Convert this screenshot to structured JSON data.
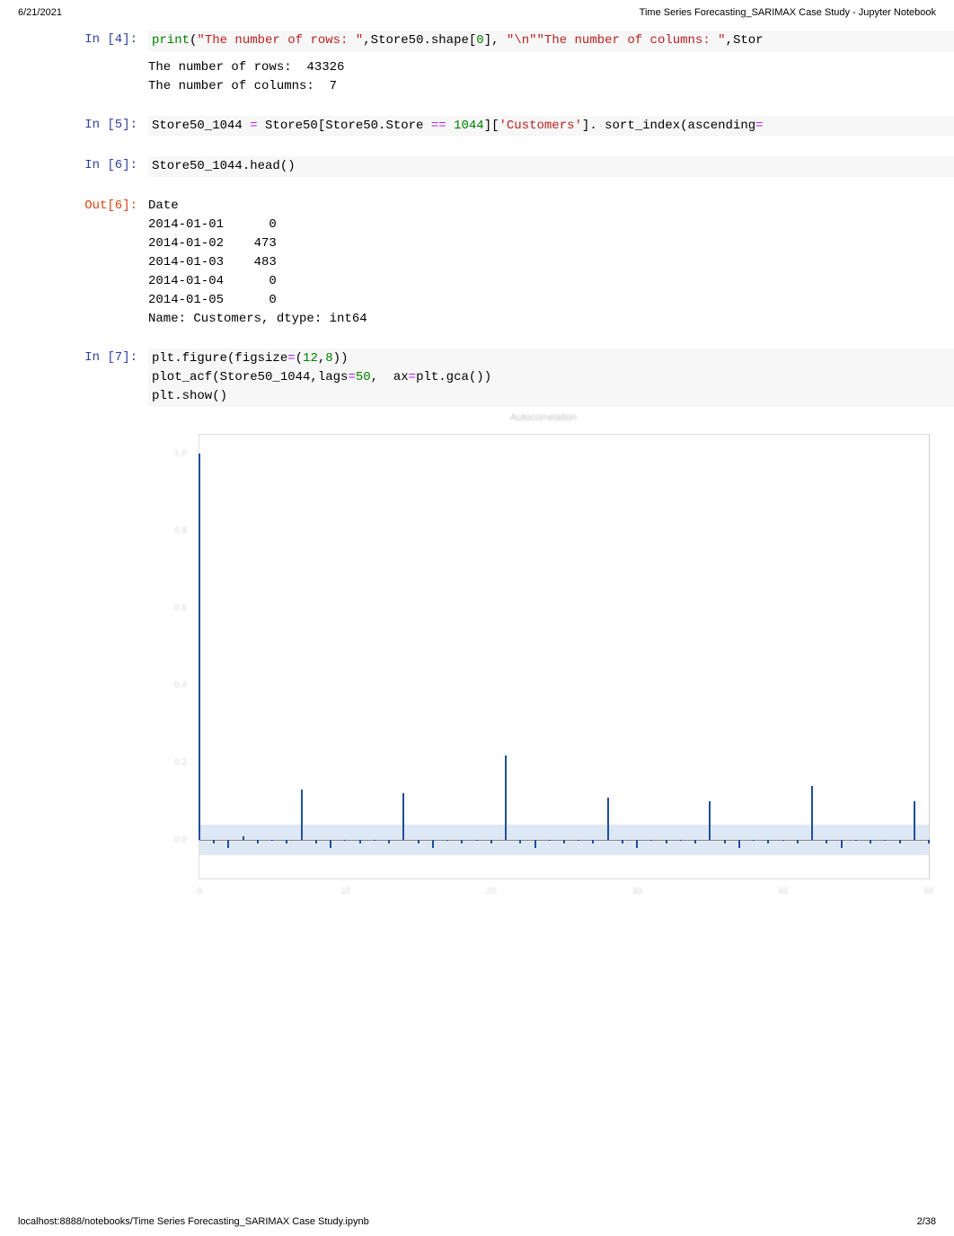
{
  "header": {
    "date": "6/21/2021",
    "title": "Time Series Forecasting_SARIMAX Case Study - Jupyter Notebook"
  },
  "cells": [
    {
      "prompt": "In [4]:",
      "code_html": "<span class='tk-k'>print</span>(<span class='tk-s'>\"The number of rows: \"</span>,Store50.shape[<span class='tk-n'>0</span>], <span class='tk-s'>\"\\n\"\"The number of columns: \"</span>,Stor",
      "output": "The number of rows:  43326\nThe number of columns:  7"
    },
    {
      "prompt": "In [5]:",
      "code_html": "Store50_1044 <span class='tk-op'>=</span> Store50[Store50.Store <span class='tk-op'>==</span> <span class='tk-n'>1044</span>][<span class='tk-s'>'Customers'</span>]. sort_index(ascending<span class='tk-op'>=</span>"
    },
    {
      "prompt": "In [6]:",
      "code_html": "Store50_1044.head()"
    },
    {
      "prompt": "Out[6]:",
      "output": "Date\n2014-01-01      0\n2014-01-02    473\n2014-01-03    483\n2014-01-04      0\n2014-01-05      0\nName: Customers, dtype: int64"
    },
    {
      "prompt": "In [7]:",
      "code_html": "plt.figure(figsize<span class='tk-op'>=</span>(<span class='tk-n'>12</span>,<span class='tk-n'>8</span>))\nplot_acf(Store50_1044,lags<span class='tk-op'>=</span><span class='tk-n'>50</span>,  ax<span class='tk-op'>=</span>plt.gca())\nplt.show()"
    }
  ],
  "chart_data": {
    "type": "bar",
    "title": "Autocorrelation",
    "xlabel": "",
    "ylabel": "",
    "xlim": [
      0,
      50
    ],
    "ylim": [
      -0.1,
      1.05
    ],
    "xticks": [
      0,
      10,
      20,
      30,
      40,
      50
    ],
    "yticks": [
      0.0,
      0.2,
      0.4,
      0.6,
      0.8,
      1.0
    ],
    "ci_band": [
      -0.04,
      0.04
    ],
    "lags": [
      0,
      1,
      2,
      3,
      4,
      5,
      6,
      7,
      8,
      9,
      10,
      11,
      12,
      13,
      14,
      15,
      16,
      17,
      18,
      19,
      20,
      21,
      22,
      23,
      24,
      25,
      26,
      27,
      28,
      29,
      30,
      31,
      32,
      33,
      34,
      35,
      36,
      37,
      38,
      39,
      40,
      41,
      42,
      43,
      44,
      45,
      46,
      47,
      48,
      49,
      50
    ],
    "values": [
      1.0,
      -0.01,
      -0.02,
      0.01,
      -0.01,
      0.0,
      -0.01,
      0.13,
      -0.01,
      -0.02,
      0.0,
      -0.01,
      0.0,
      -0.01,
      0.12,
      -0.01,
      -0.02,
      0.0,
      -0.01,
      0.0,
      -0.01,
      0.22,
      -0.01,
      -0.02,
      0.0,
      -0.01,
      0.0,
      -0.01,
      0.11,
      -0.01,
      -0.02,
      0.0,
      -0.01,
      0.0,
      -0.01,
      0.1,
      -0.01,
      -0.02,
      0.0,
      -0.01,
      0.0,
      -0.01,
      0.14,
      -0.01,
      -0.02,
      0.0,
      -0.01,
      0.0,
      -0.01,
      0.1,
      -0.01
    ]
  },
  "footer": {
    "url": "localhost:8888/notebooks/Time Series Forecasting_SARIMAX Case Study.ipynb",
    "page": "2/38"
  }
}
